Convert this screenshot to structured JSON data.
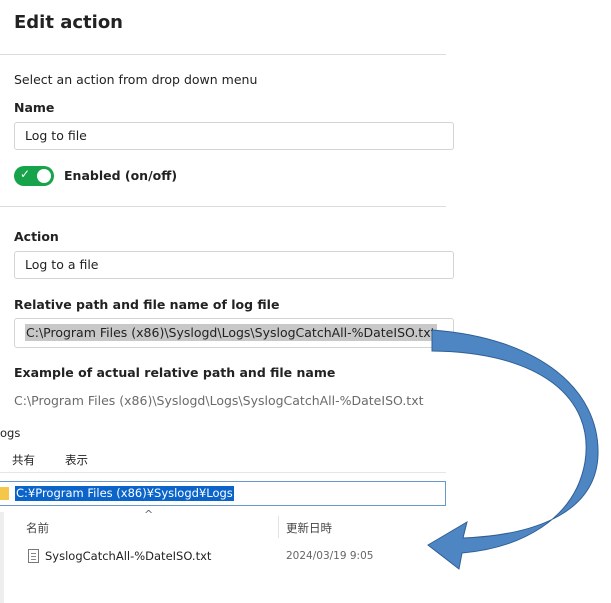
{
  "panel": {
    "title": "Edit action",
    "instruction": "Select an action from drop down menu",
    "name_label": "Name",
    "name_value": "Log to file",
    "enabled_label": "Enabled (on/off)",
    "enabled": true,
    "action_label": "Action",
    "action_value": "Log to a file",
    "path_label": "Relative path and file name of log file",
    "path_value": "C:\\Program Files (x86)\\Syslogd\\Logs\\SyslogCatchAll-%DateISO.txt",
    "example_label": "Example of actual relative path and file name",
    "example_value": "C:\\Program Files (x86)\\Syslogd\\Logs\\SyslogCatchAll-%DateISO.txt"
  },
  "explorer": {
    "title_fragment": "ogs",
    "menu": [
      "共有",
      "表示"
    ],
    "address": "C:¥Program Files (x86)¥Syslogd¥Logs",
    "columns": {
      "name": "名前",
      "date": "更新日時"
    },
    "files": [
      {
        "name": "SyslogCatchAll-%DateISO.txt",
        "modified": "2024/03/19 9:05"
      }
    ]
  },
  "colors": {
    "toggle_on": "#17a34a",
    "selection": "#0a64c9",
    "arrow_fill": "#4e86c4",
    "arrow_stroke": "#2f5f95"
  },
  "icons": [
    "check-icon",
    "folder-icon",
    "text-file-icon",
    "sort-caret-icon",
    "curved-arrow"
  ]
}
